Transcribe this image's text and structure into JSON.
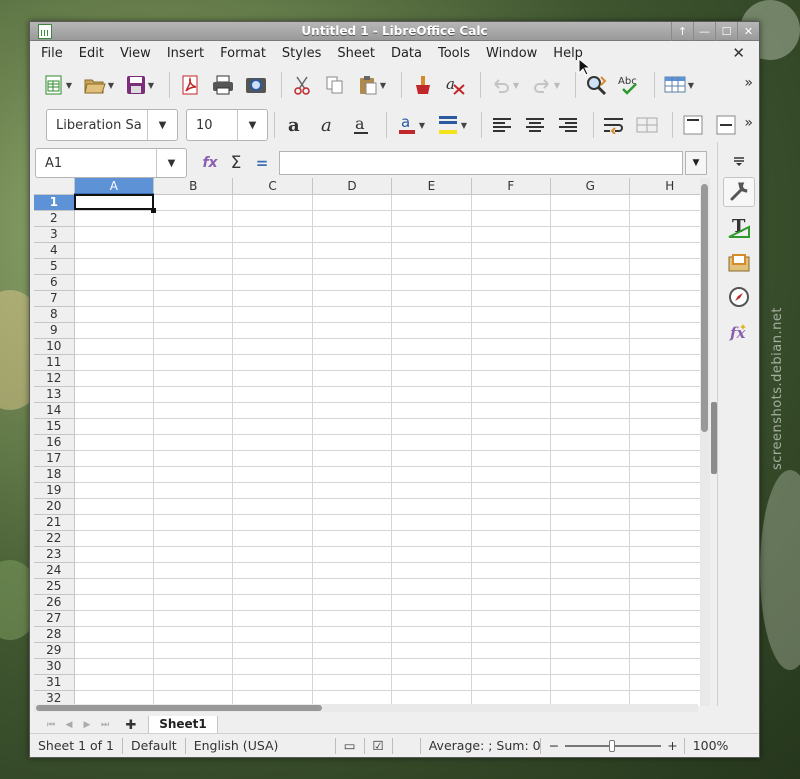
{
  "window": {
    "title": "Untitled 1 - LibreOffice Calc",
    "wm_buttons": [
      "↑",
      "—",
      "☐",
      "✕"
    ]
  },
  "menubar": {
    "items": [
      "File",
      "Edit",
      "View",
      "Insert",
      "Format",
      "Styles",
      "Sheet",
      "Data",
      "Tools",
      "Window",
      "Help"
    ],
    "close_doc": "✕"
  },
  "toolbar": {
    "icons": [
      "new-icon",
      "open-icon",
      "save-icon",
      "export-pdf-icon",
      "print-icon",
      "print-preview-icon",
      "cut-icon",
      "copy-icon",
      "paste-icon",
      "clone-formatting-icon",
      "clear-formatting-icon",
      "undo-icon",
      "redo-icon",
      "find-replace-icon",
      "spelling-icon",
      "row-col-icon"
    ],
    "more": "»"
  },
  "formatting": {
    "font_name": "Liberation Sa",
    "font_size": "10",
    "more": "»"
  },
  "formula_bar": {
    "name_box": "A1",
    "fx": "fx",
    "sum": "Σ",
    "equals": "="
  },
  "grid": {
    "columns": [
      "A",
      "B",
      "C",
      "D",
      "E",
      "F",
      "G",
      "H"
    ],
    "rows": [
      "1",
      "2",
      "3",
      "4",
      "5",
      "6",
      "7",
      "8",
      "9",
      "10",
      "11",
      "12",
      "13",
      "14",
      "15",
      "16",
      "17",
      "18",
      "19",
      "20",
      "21",
      "22",
      "23",
      "24",
      "25",
      "26",
      "27",
      "28",
      "29",
      "30",
      "31",
      "32"
    ],
    "active_cell": "A1"
  },
  "sheets": {
    "add_icon": "✚",
    "tabs": [
      "Sheet1"
    ]
  },
  "status": {
    "sheet": "Sheet 1 of 1",
    "page_style": "Default",
    "language": "English (USA)",
    "selection_summary": "Average: ; Sum: 0",
    "zoom_minus": "−",
    "zoom_plus": "+",
    "zoom": "100%"
  },
  "watermark": "screenshots.debian.net",
  "colors": {
    "accent": "#5d92d6",
    "titlebar": "#a8a8a8",
    "chrome": "#efefef"
  }
}
